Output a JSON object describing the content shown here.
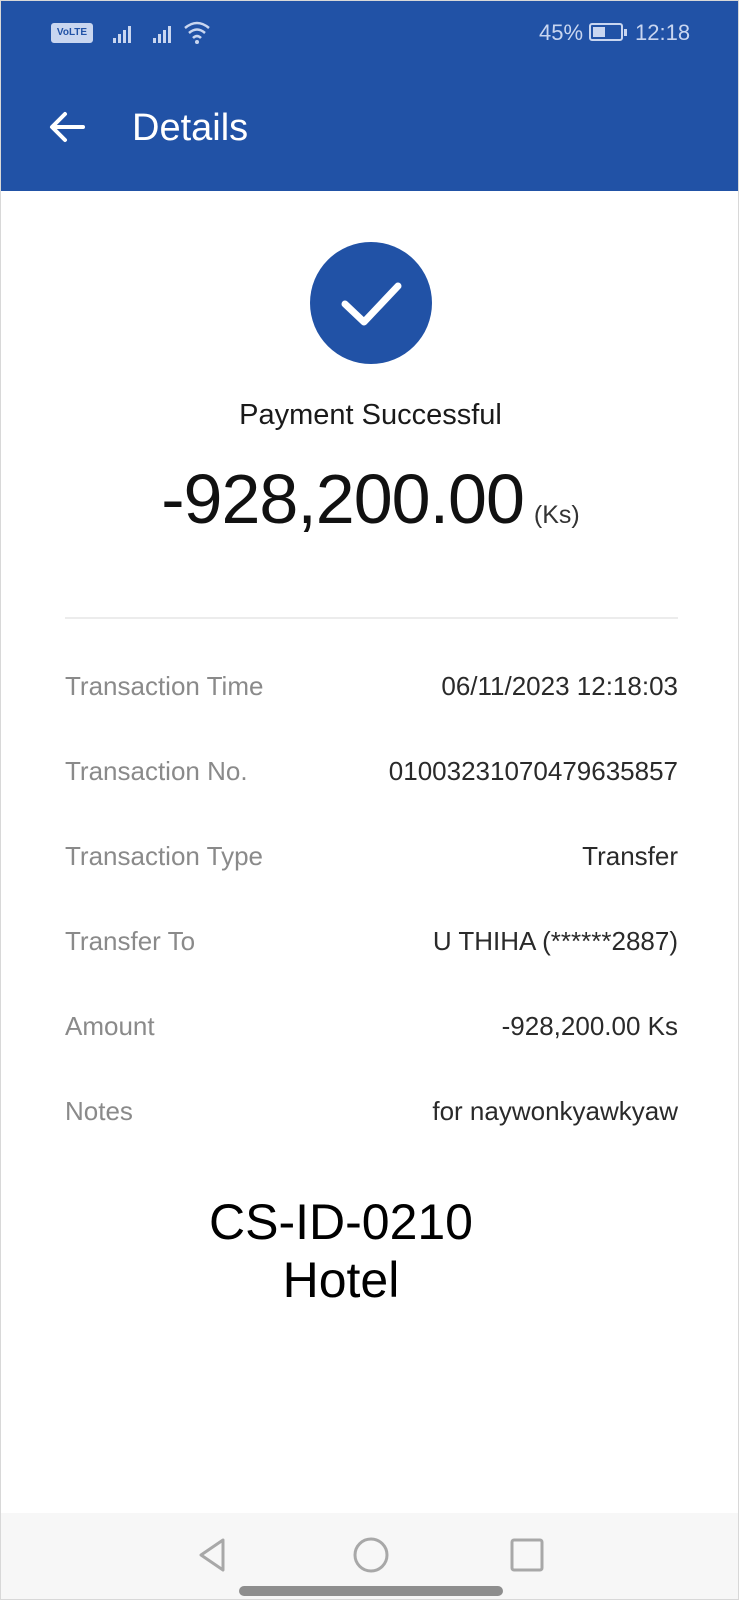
{
  "status_bar": {
    "volte_label": "VoLTE",
    "battery_percent": "45%",
    "time": "12:18"
  },
  "header": {
    "title": "Details",
    "background_color": "#2152a6"
  },
  "result": {
    "status_text": "Payment Successful",
    "amount": "-928,200.00",
    "unit": "(Ks)",
    "accent_color": "#2152a6"
  },
  "details": [
    {
      "label": "Transaction Time",
      "value": "06/11/2023 12:18:03"
    },
    {
      "label": "Transaction No.",
      "value": "01003231070479635857"
    },
    {
      "label": "Transaction Type",
      "value": "Transfer"
    },
    {
      "label": "Transfer To",
      "value": "U THIHA (******2887)"
    },
    {
      "label": "Amount",
      "value": "-928,200.00 Ks"
    },
    {
      "label": "Notes",
      "value": "for naywonkyawkyaw"
    }
  ],
  "overlay": {
    "line1": "CS-ID-0210",
    "line2": "Hotel"
  },
  "icons": {
    "back": "arrow-left-icon",
    "success": "checkmark-icon",
    "nav_back": "triangle-back-icon",
    "nav_home": "circle-home-icon",
    "nav_recents": "square-recents-icon"
  }
}
